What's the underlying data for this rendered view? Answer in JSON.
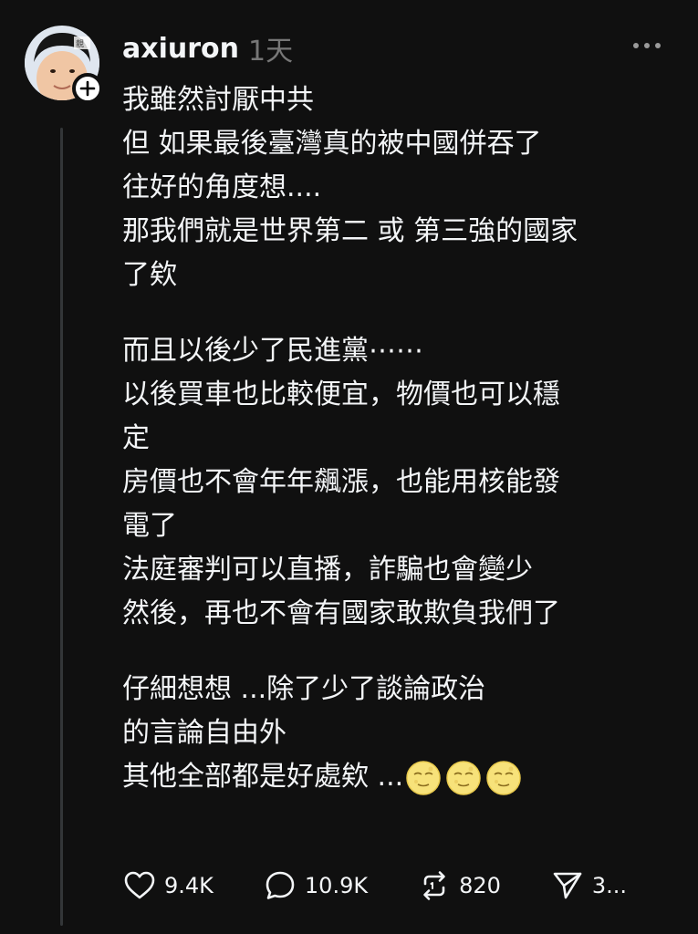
{
  "post": {
    "username": "axiuron",
    "timestamp": "1天",
    "avatar_label": "靚",
    "paragraphs": [
      [
        "我雖然討厭中共",
        "但 如果最後臺灣真的被中國併吞了",
        "往好的角度想....",
        "那我們就是世界第二 或 第三強的國家",
        "了欸"
      ],
      [
        "而且以後少了民進黨⋯⋯",
        "以後買車也比較便宜，物價也可以穩",
        "定",
        "房價也不會年年飆漲，也能用核能發",
        "電了",
        "法庭審判可以直播，詐騙也會變少",
        "然後，再也不會有國家敢欺負我們了"
      ],
      [
        "仔細想想 ...除了少了談論政治",
        "的言論自由外",
        "其他全部都是好處欸 ..."
      ]
    ],
    "emojis": [
      "moon-face-emoji",
      "moon-face-emoji",
      "moon-face-emoji"
    ]
  },
  "actions": {
    "likes": "9.4K",
    "comments": "10.9K",
    "reposts": "820",
    "shares": "3..."
  },
  "icons": {
    "more": "more-dots-icon",
    "like": "heart-icon",
    "comment": "comment-bubble-icon",
    "repost": "repost-icon",
    "share": "send-icon",
    "follow": "plus-icon"
  },
  "colors": {
    "background": "#101010",
    "text": "#f3f5f7",
    "muted": "#777777",
    "thread_line": "#333638"
  }
}
